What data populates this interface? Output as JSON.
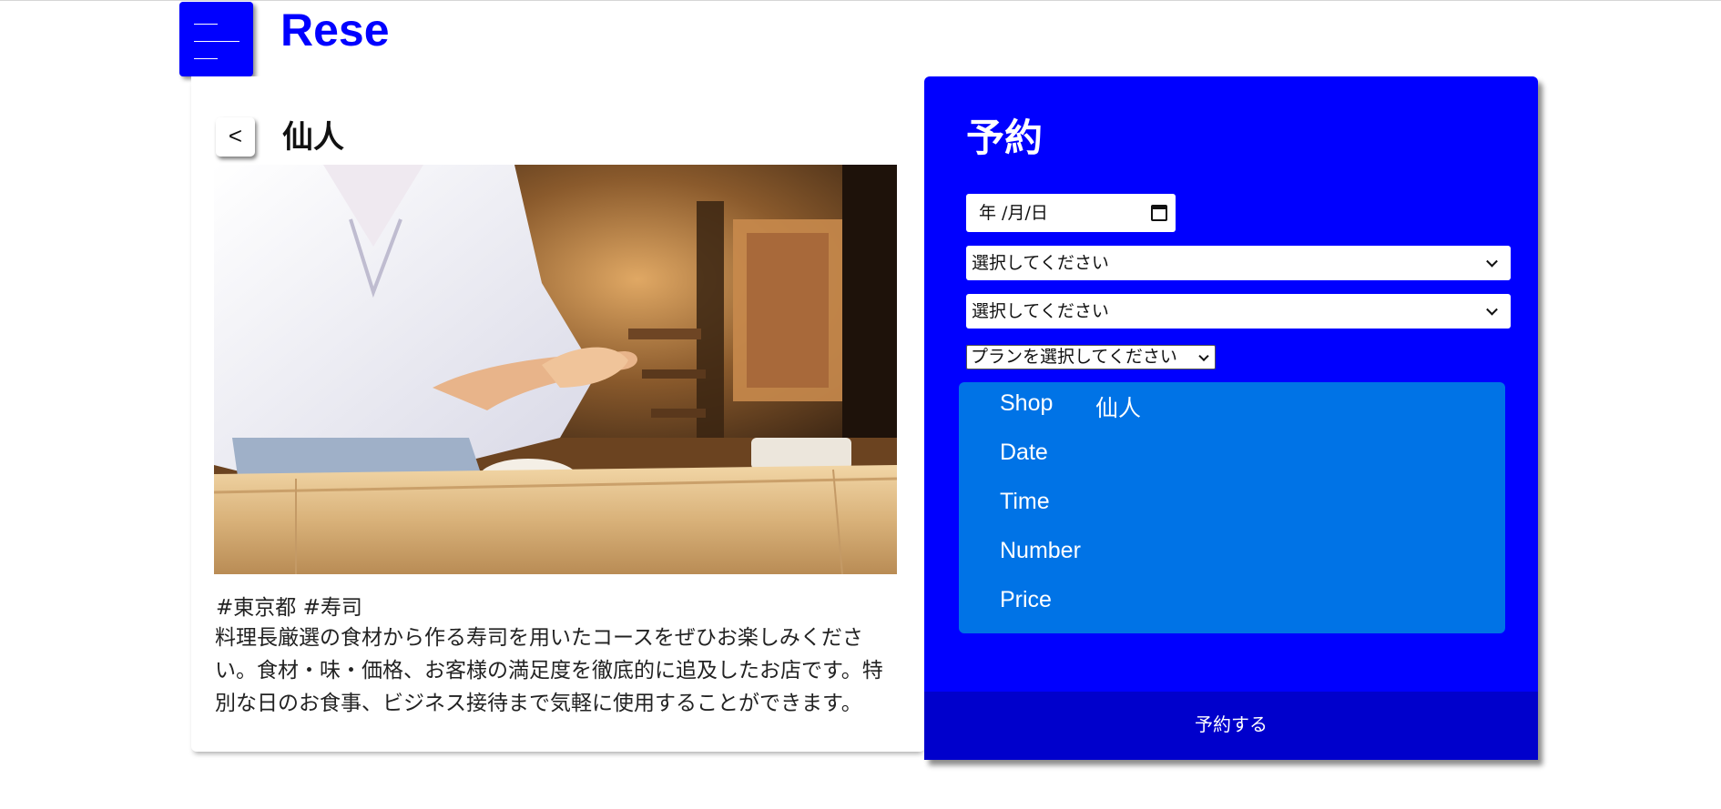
{
  "header": {
    "logo": "Rese",
    "menu_icon": "hamburger-icon"
  },
  "shop": {
    "back_label": "<",
    "name": "仙人",
    "tags": "#東京都 #寿司",
    "description": "料理長厳選の食材から作る寿司を用いたコースをぜひお楽しみください。食材・味・価格、お客様の満足度を徹底的に追及したお店です。特別な日のお食事、ビジネス接待まで気軽に使用することができます。"
  },
  "reservation": {
    "title": "予約",
    "date_placeholder": "年 /月/日",
    "time_select": "選択してください",
    "number_select": "選択してください",
    "plan_select": "プランを選択してください",
    "summary": {
      "shop_label": "Shop",
      "shop_value": "仙人",
      "date_label": "Date",
      "time_label": "Time",
      "number_label": "Number",
      "price_label": "Price"
    },
    "submit_label": "予約する"
  },
  "colors": {
    "brand": "#0000ff",
    "summary_bg": "#0073e6",
    "submit_bg": "#0000cc"
  }
}
